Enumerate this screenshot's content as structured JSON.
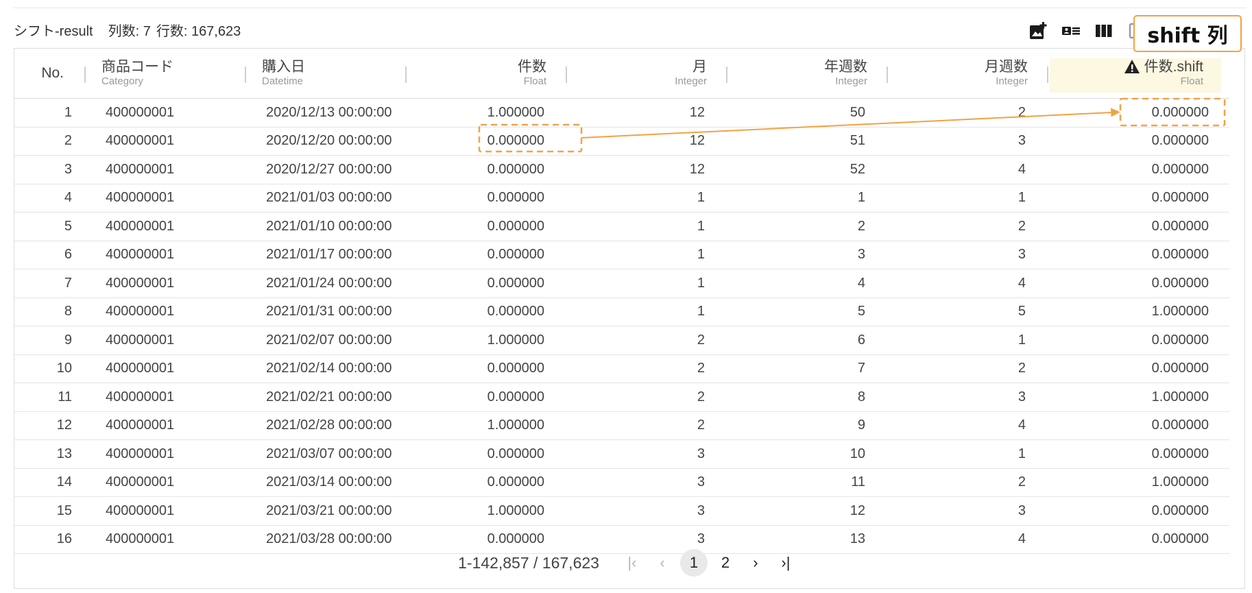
{
  "header": {
    "title": "シフト-result",
    "col_count_label": "列数: 7",
    "row_count_label": "行数: 167,623"
  },
  "toolbar": {
    "icons": [
      "add-image-icon",
      "card-list-icon",
      "columns-icon",
      "copy-icon"
    ]
  },
  "callout": {
    "label": "shift 列"
  },
  "columns": [
    {
      "name": "No.",
      "type": ""
    },
    {
      "name": "商品コード",
      "type": "Category"
    },
    {
      "name": "購入日",
      "type": "Datetime"
    },
    {
      "name": "件数",
      "type": "Float"
    },
    {
      "name": "月",
      "type": "Integer"
    },
    {
      "name": "年週数",
      "type": "Integer"
    },
    {
      "name": "月週数",
      "type": "Integer"
    },
    {
      "name": "件数.shift",
      "type": "Float"
    }
  ],
  "rows": [
    [
      "1",
      "400000001",
      "2020/12/13 00:00:00",
      "1.000000",
      "12",
      "50",
      "2",
      "0.000000"
    ],
    [
      "2",
      "400000001",
      "2020/12/20 00:00:00",
      "0.000000",
      "12",
      "51",
      "3",
      "0.000000"
    ],
    [
      "3",
      "400000001",
      "2020/12/27 00:00:00",
      "0.000000",
      "12",
      "52",
      "4",
      "0.000000"
    ],
    [
      "4",
      "400000001",
      "2021/01/03 00:00:00",
      "0.000000",
      "1",
      "1",
      "1",
      "0.000000"
    ],
    [
      "5",
      "400000001",
      "2021/01/10 00:00:00",
      "0.000000",
      "1",
      "2",
      "2",
      "0.000000"
    ],
    [
      "6",
      "400000001",
      "2021/01/17 00:00:00",
      "0.000000",
      "1",
      "3",
      "3",
      "0.000000"
    ],
    [
      "7",
      "400000001",
      "2021/01/24 00:00:00",
      "0.000000",
      "1",
      "4",
      "4",
      "0.000000"
    ],
    [
      "8",
      "400000001",
      "2021/01/31 00:00:00",
      "0.000000",
      "1",
      "5",
      "5",
      "1.000000"
    ],
    [
      "9",
      "400000001",
      "2021/02/07 00:00:00",
      "1.000000",
      "2",
      "6",
      "1",
      "0.000000"
    ],
    [
      "10",
      "400000001",
      "2021/02/14 00:00:00",
      "0.000000",
      "2",
      "7",
      "2",
      "0.000000"
    ],
    [
      "11",
      "400000001",
      "2021/02/21 00:00:00",
      "0.000000",
      "2",
      "8",
      "3",
      "1.000000"
    ],
    [
      "12",
      "400000001",
      "2021/02/28 00:00:00",
      "1.000000",
      "2",
      "9",
      "4",
      "0.000000"
    ],
    [
      "13",
      "400000001",
      "2021/03/07 00:00:00",
      "0.000000",
      "3",
      "10",
      "1",
      "0.000000"
    ],
    [
      "14",
      "400000001",
      "2021/03/14 00:00:00",
      "0.000000",
      "3",
      "11",
      "2",
      "1.000000"
    ],
    [
      "15",
      "400000001",
      "2021/03/21 00:00:00",
      "1.000000",
      "3",
      "12",
      "3",
      "0.000000"
    ],
    [
      "16",
      "400000001",
      "2021/03/28 00:00:00",
      "0.000000",
      "3",
      "13",
      "4",
      "0.000000"
    ]
  ],
  "pagination": {
    "range": "1-142,857 / 167,623",
    "first": "|‹",
    "prev": "‹",
    "pages": [
      "1",
      "2"
    ],
    "current_page": "1",
    "next": "›",
    "last": "›|"
  },
  "colors": {
    "accent_orange": "#f2a243",
    "highlight_header": "#fdf8e1"
  }
}
